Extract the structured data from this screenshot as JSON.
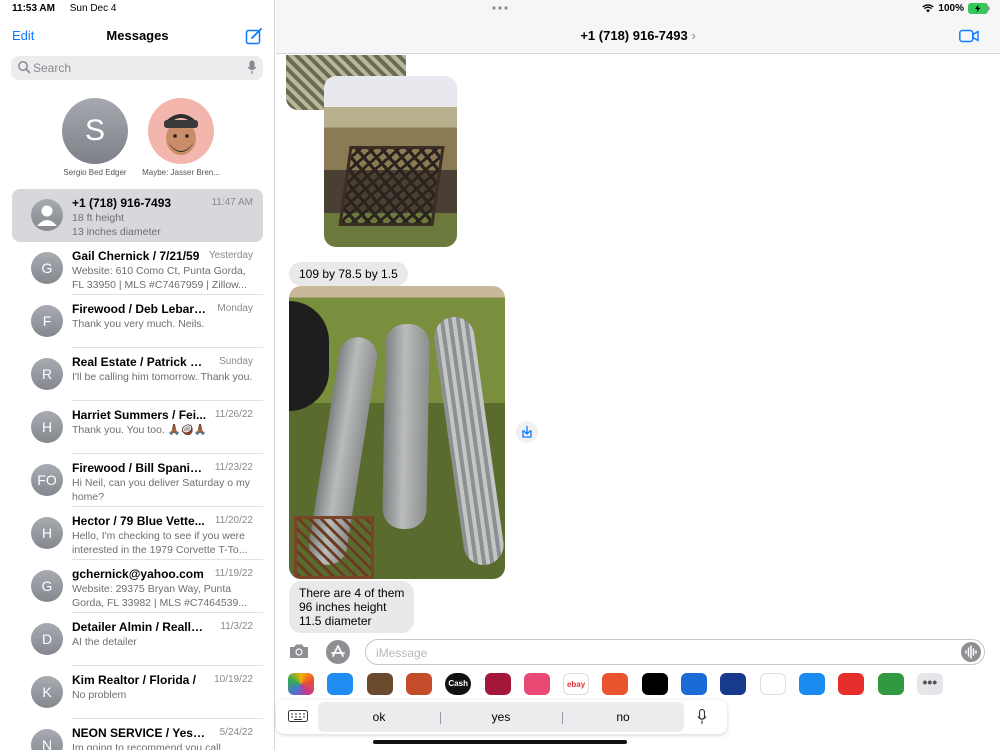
{
  "status": {
    "time": "11:53 AM",
    "date": "Sun Dec 4",
    "battery": "100%"
  },
  "sidebar": {
    "edit": "Edit",
    "title": "Messages",
    "search_placeholder": "Search",
    "pinned": [
      {
        "initial": "S",
        "name": "Sergio Bed Edger"
      },
      {
        "initial": "",
        "name": "Maybe: Jasser Bren..."
      }
    ],
    "conversations": [
      {
        "initial": "",
        "name": "+1 (718) 916-7493",
        "time": "11:47 AM",
        "preview": "18 ft height\n13 inches diameter",
        "selected": true
      },
      {
        "initial": "G",
        "name": "Gail Chernick / 7/21/59",
        "time": "Yesterday",
        "preview": "Website: 610 Como Ct, Punta Gorda, FL 33950 | MLS #C7467959 | Zillow..."
      },
      {
        "initial": "F",
        "name": "Firewood / Deb Lebaro...",
        "time": "Monday",
        "preview": "Thank you very much. Neils."
      },
      {
        "initial": "R",
        "name": "Real Estate / Patrick Co...",
        "time": "Sunday",
        "preview": "I'll be calling him tomorrow. Thank you."
      },
      {
        "initial": "H",
        "name": "Harriet Summers / Fei...",
        "time": "11/26/22",
        "preview": "Thank you. You too. 🙏🏾🥥🙏🏾"
      },
      {
        "initial": "FO",
        "name": "Firewood / Bill Spanier...",
        "time": "11/23/22",
        "preview": "Hi Neil, can you deliver Saturday o my home?"
      },
      {
        "initial": "H",
        "name": "Hector / 79 Blue Vette...",
        "time": "11/20/22",
        "preview": "Hello, I'm checking to see if you were interested in the 1979 Corvette T-To..."
      },
      {
        "initial": "G",
        "name": "gchernick@yahoo.com",
        "time": "11/19/22",
        "preview": "Website: 29375 Bryan Way, Punta Gorda, FL 33982 | MLS #C7464539..."
      },
      {
        "initial": "D",
        "name": "Detailer Almin / Really N...",
        "time": "11/3/22",
        "preview": "AI  the detailer"
      },
      {
        "initial": "K",
        "name": "Kim Realtor / Florida /",
        "time": "10/19/22",
        "preview": "No problem"
      },
      {
        "initial": "N",
        "name": "NEON SERVICE / Yesco...",
        "time": "5/24/22",
        "preview": "Im going to recommend you call"
      }
    ]
  },
  "chat": {
    "contact": "+1 (718) 916-7493",
    "messages": {
      "dims": "109 by 78.5 by 1.5",
      "count_line1": "There are 4 of them",
      "count_line2": "96 inches height",
      "count_line3": "11.5 diameter"
    },
    "input_placeholder": "iMessage",
    "apps": [
      "photos-app",
      "app-store-app",
      "memoji-app",
      "memoji-2-app",
      "cash-app",
      "heart-app",
      "search-app",
      "ebay-app",
      "paint-app",
      "notes-app",
      "zillow-app",
      "united-app",
      "american-app",
      "shazam-app",
      "youtube-app",
      "weather-app",
      "more-app"
    ],
    "app_labels": {
      "cash": "Cash",
      "ebay": "ebay"
    },
    "suggestions": [
      "ok",
      "yes",
      "no"
    ]
  }
}
